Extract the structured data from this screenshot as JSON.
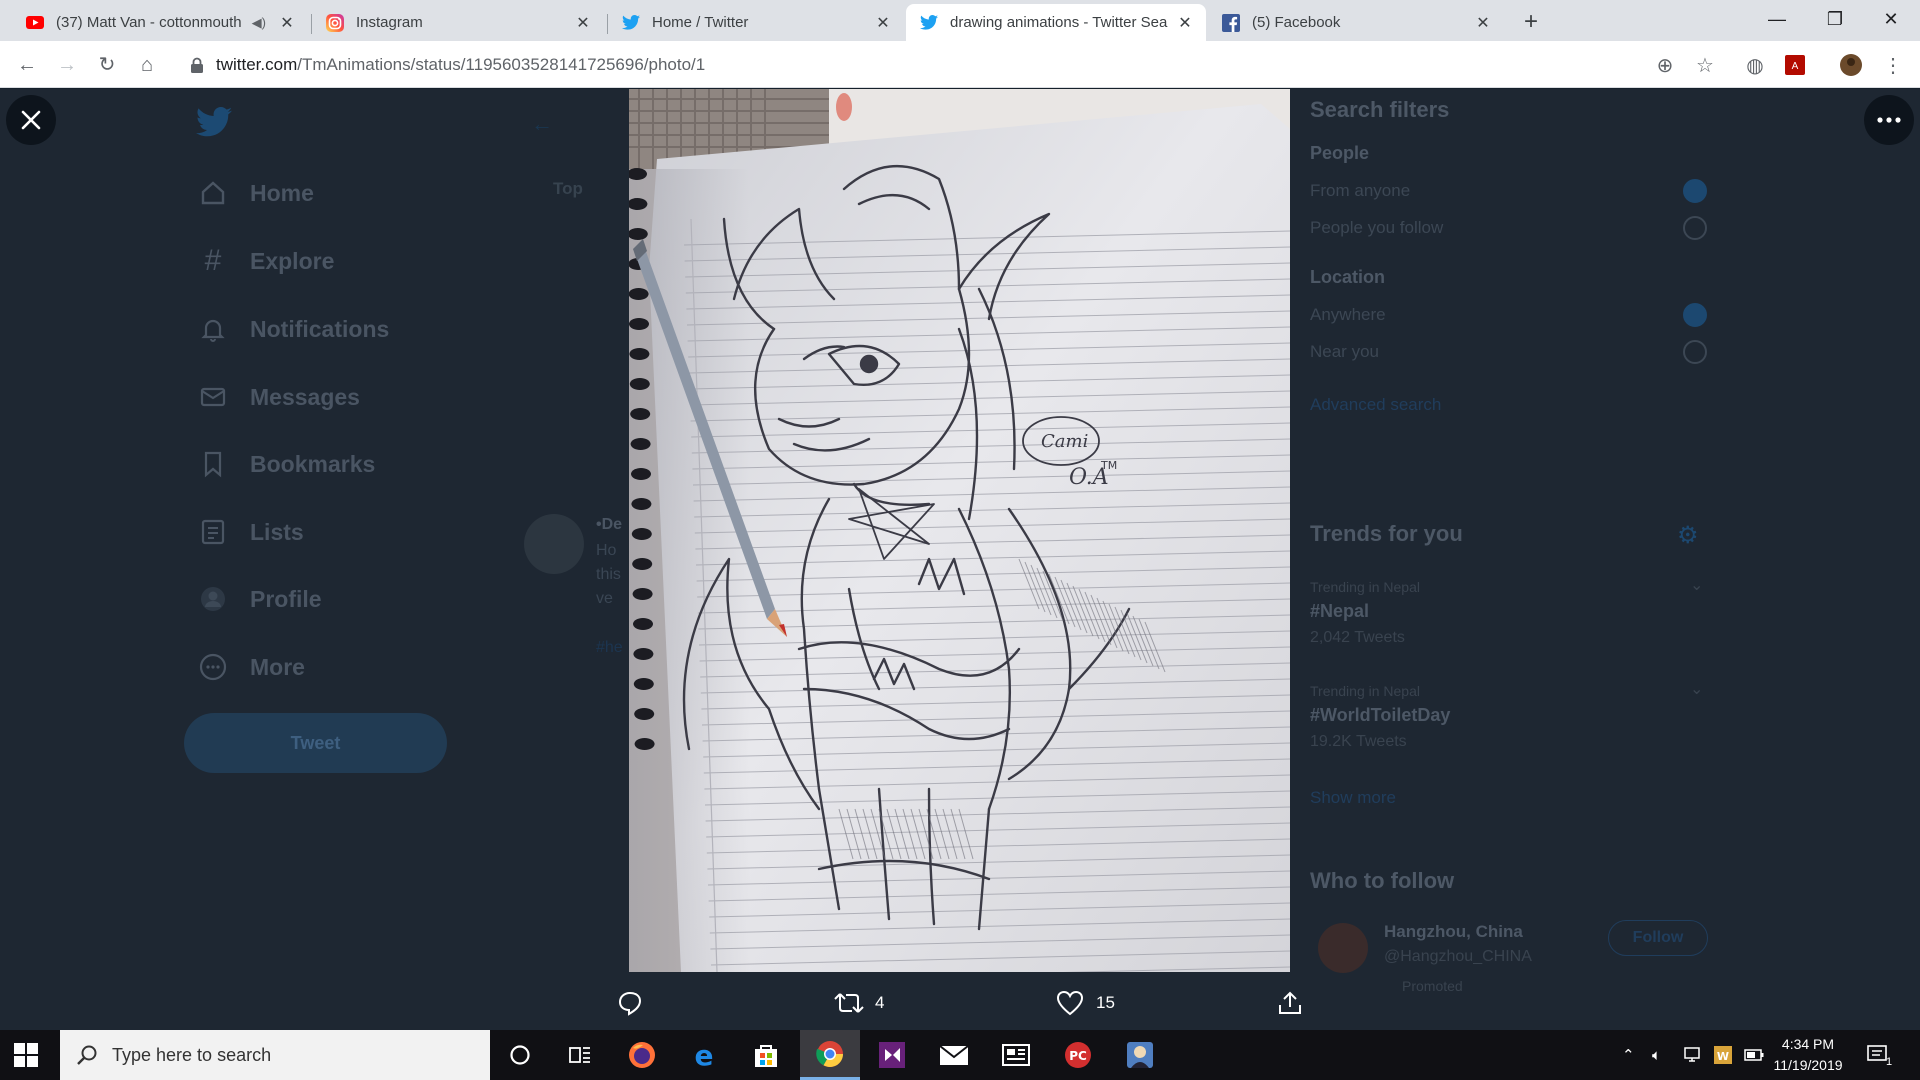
{
  "browser": {
    "tabs": [
      {
        "title": "(37) Matt Van - cottonmouth",
        "icon": "youtube-icon",
        "muted": true,
        "active": false
      },
      {
        "title": "Instagram",
        "icon": "instagram-icon",
        "active": false
      },
      {
        "title": "Home / Twitter",
        "icon": "twitter-icon",
        "active": false
      },
      {
        "title": "drawing animations - Twitter Sea",
        "icon": "twitter-icon",
        "active": true
      },
      {
        "title": "(5) Facebook",
        "icon": "facebook-icon",
        "active": false
      }
    ],
    "url_host": "twitter.com",
    "url_path": "/TmAnimations/status/1195603528141725696/photo/1"
  },
  "twitter": {
    "nav": [
      {
        "label": "Home",
        "icon": "home-icon"
      },
      {
        "label": "Explore",
        "icon": "hashtag-icon"
      },
      {
        "label": "Notifications",
        "icon": "bell-icon"
      },
      {
        "label": "Messages",
        "icon": "envelope-icon"
      },
      {
        "label": "Bookmarks",
        "icon": "bookmark-icon"
      },
      {
        "label": "Lists",
        "icon": "list-icon"
      },
      {
        "label": "Profile",
        "icon": "profile-icon"
      },
      {
        "label": "More",
        "icon": "more-circle-icon"
      }
    ],
    "tweet_button": "Tweet",
    "middle": {
      "tab_top": "Top",
      "frag_name": "•De",
      "frag_line1": "Ho",
      "frag_line2": "this",
      "frag_line3": "ve",
      "frag_hash": "#he"
    },
    "search_filters": {
      "title": "Search filters",
      "people_heading": "People",
      "people_options": [
        "From anyone",
        "People you follow"
      ],
      "location_heading": "Location",
      "location_options": [
        "Anywhere",
        "Near you"
      ],
      "advanced": "Advanced search"
    },
    "trends": {
      "title": "Trends for you",
      "items": [
        {
          "context": "Trending in Nepal",
          "tag": "#Nepal",
          "count": "2,042 Tweets"
        },
        {
          "context": "Trending in Nepal",
          "tag": "#WorldToiletDay",
          "count": "19.2K Tweets"
        }
      ],
      "show_more": "Show more"
    },
    "who_to_follow": {
      "title": "Who to follow",
      "name": "Hangzhou, China",
      "handle": "@Hangzhou_CHINA",
      "promoted": "Promoted",
      "follow": "Follow"
    }
  },
  "viewer": {
    "retweets": "4",
    "likes": "15",
    "signature_line1": "Cami",
    "signature_line2": "O.A",
    "signature_tm": "TM"
  },
  "taskbar": {
    "search_placeholder": "Type here to search",
    "time": "4:34 PM",
    "date": "11/19/2019",
    "notification_count": "1"
  }
}
